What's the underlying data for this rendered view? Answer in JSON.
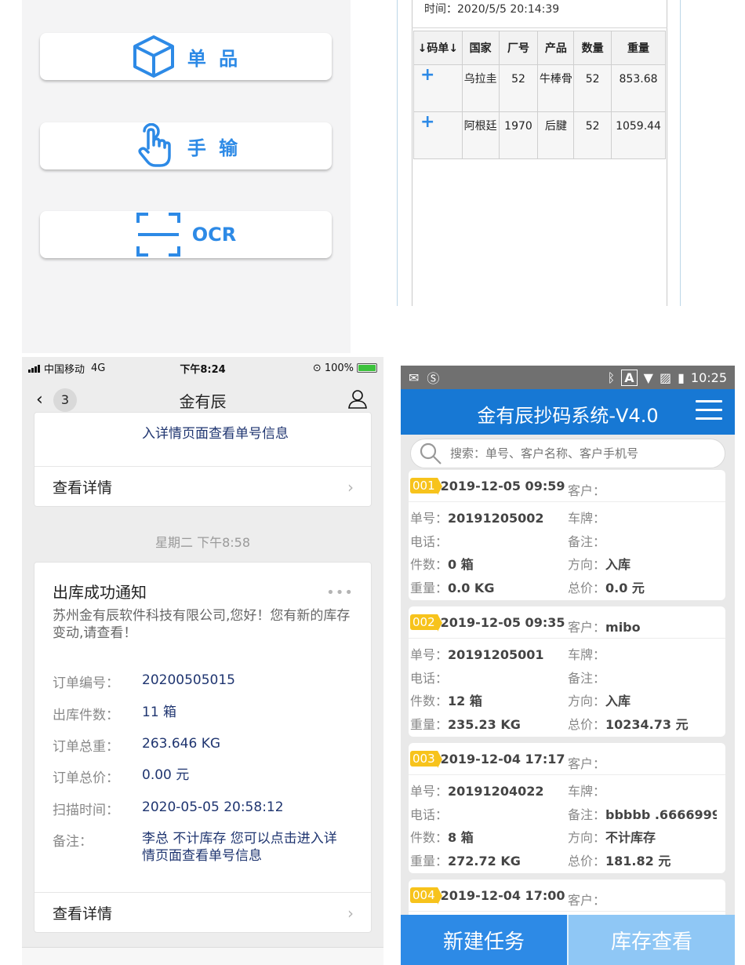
{
  "menu": {
    "items": [
      {
        "label": "单 品",
        "icon": "cube-icon"
      },
      {
        "label": "手 输",
        "icon": "hand-pointer-icon"
      },
      {
        "label": "OCR",
        "icon": "scan-frame-icon"
      }
    ],
    "accent": "#2d8ae6"
  },
  "result": {
    "time": "时间：2020/5/5 20:14:39",
    "columns": [
      "↓码单↓",
      "国家",
      "厂号",
      "产品",
      "数量",
      "重量"
    ],
    "rows": [
      {
        "plus": "+",
        "country": "乌拉圭",
        "factory": "52",
        "product": "牛棒骨",
        "qty": "52",
        "weight": "853.68"
      },
      {
        "plus": "+",
        "country": "阿根廷",
        "factory": "1970",
        "product": "后腱",
        "qty": "52",
        "weight": "1059.44"
      }
    ]
  },
  "wechat": {
    "status": {
      "carrier": "中国移动",
      "network": "4G",
      "time": "下午8:24",
      "battery": "100%"
    },
    "nav": {
      "back_count": "3",
      "title": "金有辰"
    },
    "prev_card": {
      "tail_text": "入详情页面查看单号信息",
      "detail_label": "查看详情"
    },
    "day_stamp": "星期二 下午8:58",
    "notice": {
      "title": "出库成功通知",
      "more": "•••",
      "desc": "苏州金有辰软件科技有限公司,您好！您有新的库存变动,请查看！",
      "fields": [
        {
          "k": "订单编号：",
          "v": "20200505015"
        },
        {
          "k": "出库件数：",
          "v": "11 箱"
        },
        {
          "k": "订单总重：",
          "v": "263.646 KG"
        },
        {
          "k": "订单总价：",
          "v": "0.00 元"
        },
        {
          "k": "扫描时间：",
          "v": "2020-05-05 20:58:12"
        },
        {
          "k": "备注：",
          "v": "李总 不计库存 您可以点击进入详情页面查看单号信息"
        }
      ],
      "detail_label": "查看详情"
    }
  },
  "app": {
    "status_time": "10:25",
    "title": "金有辰抄码系统-V4.0",
    "search_placeholder": "搜索：单号、客户名称、客户手机号",
    "primary_color": "#1778d4",
    "records": [
      {
        "no": "001",
        "datetime": "2019-12-05 09:59",
        "customer": "",
        "order": "20191205002",
        "plate": "",
        "phone": "",
        "note": "",
        "count": "0 箱",
        "direction": "入库",
        "weight": "0.0 KG",
        "total": "0.0 元"
      },
      {
        "no": "002",
        "datetime": "2019-12-05 09:35",
        "customer": "mibo",
        "order": "20191205001",
        "plate": "",
        "phone": "",
        "note": "",
        "count": "12 箱",
        "direction": "入库",
        "weight": "235.23 KG",
        "total": "10234.73 元"
      },
      {
        "no": "003",
        "datetime": "2019-12-04 17:17",
        "customer": "",
        "order": "20191204022",
        "plate": "",
        "phone": "",
        "note": "bbbbb .6666999...",
        "count": "8 箱",
        "direction": "不计库存",
        "weight": "272.72 KG",
        "total": "181.82 元"
      },
      {
        "no": "004",
        "datetime": "2019-12-04 17:00",
        "customer": "",
        "order": "",
        "plate": "",
        "phone": "",
        "note": "",
        "count": "",
        "direction": "",
        "weight": "",
        "total": ""
      }
    ],
    "labels": {
      "customer": "客户：",
      "order": "单号：",
      "plate": "车牌：",
      "phone": "电话：",
      "note": "备注：",
      "count": "件数：",
      "direction": "方向：",
      "weight": "重量：",
      "total": "总价："
    },
    "bottom": {
      "new_task": "新建任务",
      "stock": "库存查看"
    }
  }
}
